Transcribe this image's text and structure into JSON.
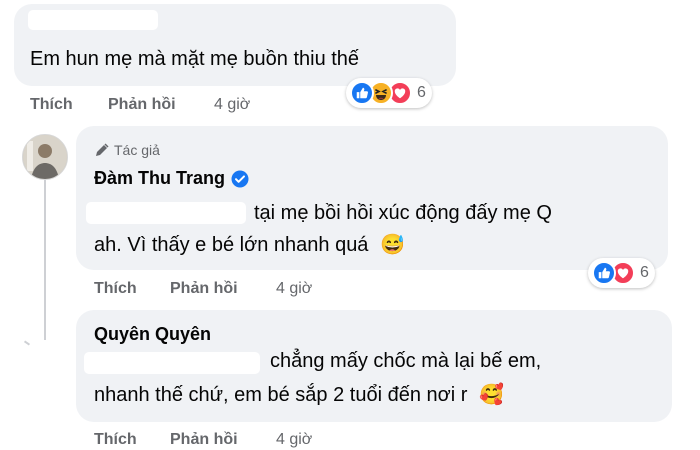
{
  "comment1": {
    "text": "Em hun mẹ mà mặt mẹ buồn thiu thế",
    "actions": {
      "like": "Thích",
      "reply": "Phản hồi",
      "time": "4 giờ"
    },
    "reactions": {
      "icons": [
        "like-icon",
        "haha-icon",
        "love-icon"
      ],
      "count": "6"
    }
  },
  "reply1": {
    "badge": "Tác giả",
    "author": "Đàm Thu Trang",
    "line1": "tại mẹ bồi hồi xúc động đấy mẹ Q",
    "line2": "ah. Vì thấy e bé lớn nhanh quá",
    "emoji": "😅",
    "actions": {
      "like": "Thích",
      "reply": "Phản hồi",
      "time": "4 giờ"
    },
    "reactions": {
      "icons": [
        "like-icon",
        "love-icon"
      ],
      "count": "6"
    }
  },
  "reply2": {
    "author": "Quyên Quyên",
    "line1": "chẳng mấy chốc mà lại bế em,",
    "line2": "nhanh thế chứ, em bé sắp 2 tuổi đến nơi r",
    "emoji": "🥰",
    "actions": {
      "like": "Thích",
      "reply": "Phản hồi",
      "time": "4 giờ"
    }
  },
  "colors": {
    "bubble": "#f0f2f5",
    "meta": "#65676b",
    "like_blue": "#1877f2",
    "love_red": "#f33e58",
    "haha_yellow": "#f7b125"
  }
}
